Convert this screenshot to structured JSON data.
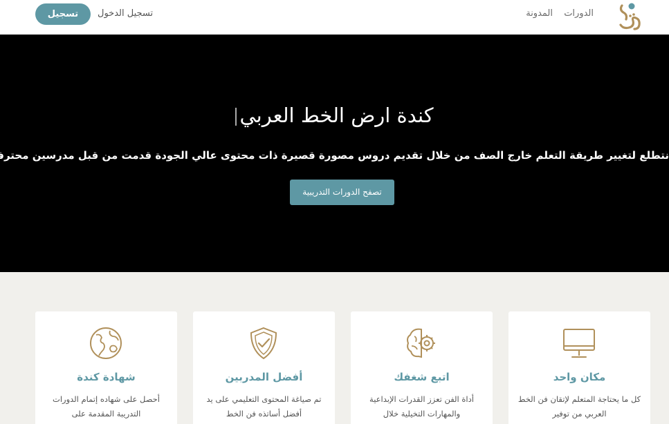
{
  "nav": {
    "courses": "الدورات",
    "blog": "المدونة",
    "login": "تسجيل الدخول",
    "signup": "تسجيل"
  },
  "hero": {
    "title": "كندة ارض الخط العربي",
    "subtitle": "نتطلع لتغيير طريقة التعلم خارج الصف من خلال تقديم دروس مصورة قصيرة ذات محتوى عالي الجودة قدمت من قبل مدرسين محترفين",
    "cta": "تصفح الدورات التدريبية"
  },
  "features": [
    {
      "icon": "monitor-icon",
      "title": "مكان واحد",
      "text": "كل ما يحتاجة المتعلم لإتقان فن الخط العربي من توفير"
    },
    {
      "icon": "brain-gear-icon",
      "title": "اتبع شغفك",
      "text": "أداة الفن تعزز القدرات الإبداعية والمهارات التخيلية خلال"
    },
    {
      "icon": "shield-check-icon",
      "title": "أفضل المدربين",
      "text": "تم صياغة المحتوى التعليمي على يد أفضل أساتذه فن الخط"
    },
    {
      "icon": "globe-icon",
      "title": "شهادة كندة",
      "text": "أحصل على شهاده إتمام الدورات التدريبة المقدمة على"
    }
  ],
  "colors": {
    "accent": "#5e98a4",
    "gold": "#b0905a",
    "hero_bg": "#000000",
    "section_bg": "#f1f0ec"
  }
}
